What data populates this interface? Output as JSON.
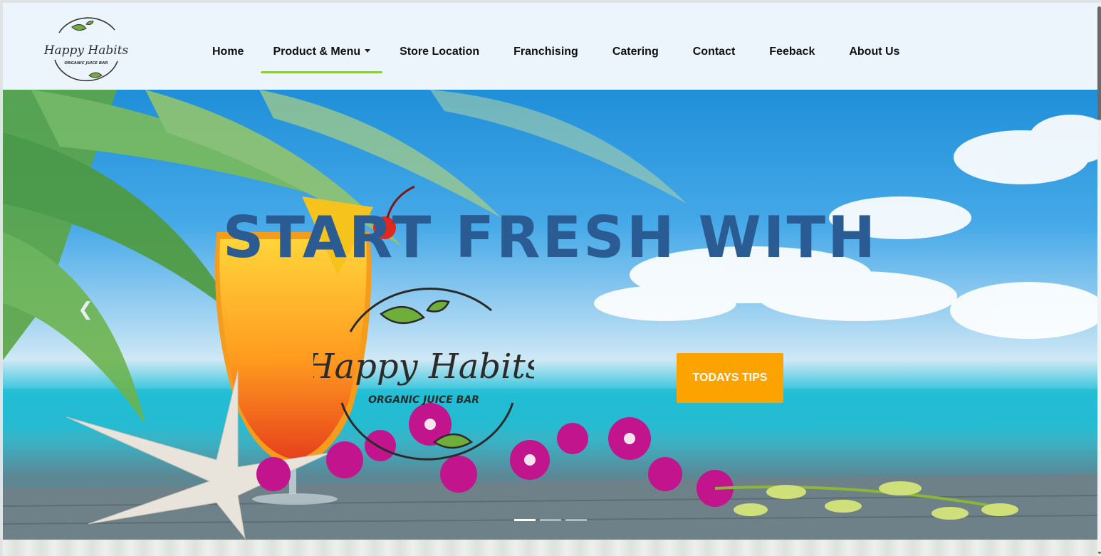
{
  "brand": {
    "name": "Happy Habits",
    "tagline": "ORGANIC JUICE BAR"
  },
  "nav": {
    "items": [
      {
        "label": "Home"
      },
      {
        "label": "Product & Menu"
      },
      {
        "label": "Store Location"
      },
      {
        "label": "Franchising"
      },
      {
        "label": "Catering"
      },
      {
        "label": "Contact"
      },
      {
        "label": "Feeback"
      },
      {
        "label": "About Us"
      }
    ],
    "active_index": 1
  },
  "hero": {
    "headline": "START FRESH WITH",
    "cta_label": "TODAYS TIPS",
    "prev_icon": "chevron-left-icon",
    "slides": 3,
    "active_slide": 0
  },
  "colors": {
    "accent": "#8ccd3c",
    "cta": "#fda300",
    "headline": "#2a5b93",
    "header_bg": "#edf5fc"
  }
}
